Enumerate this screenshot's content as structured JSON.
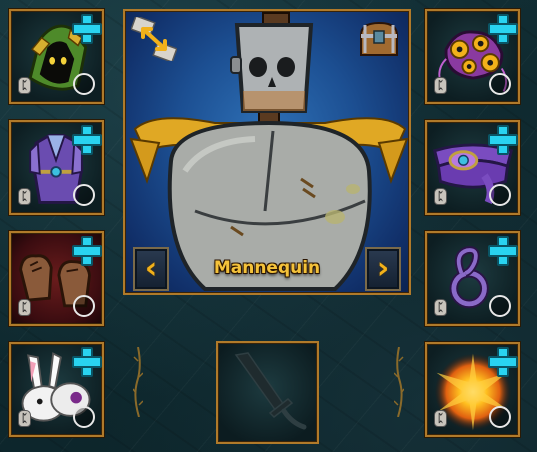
{
  "mannequin": {
    "name": "Mannequin",
    "prev_label": "‹",
    "next_label": "›"
  },
  "slots": {
    "rune_glyph": "ᛈ",
    "left": [
      {
        "item": "green hood"
      },
      {
        "item": "purple armor"
      },
      {
        "item": "brown gloves"
      },
      {
        "item": "bunny slippers"
      }
    ],
    "right": [
      {
        "item": "eyeball amulet"
      },
      {
        "item": "purple belt"
      },
      {
        "item": "purple ring"
      },
      {
        "item": "explosion charm"
      }
    ]
  },
  "colors": {
    "frame_gold": "#b07a2a",
    "plus_cyan": "#29d3f0",
    "name_gold": "#f4c23a",
    "panel_blue": "#1c4f92"
  },
  "icons": [
    "plus-icon",
    "rune-icon",
    "swap-arrows-icon",
    "treasure-chest-icon",
    "chevron-left-icon",
    "chevron-right-icon",
    "sword-silhouette-icon"
  ]
}
